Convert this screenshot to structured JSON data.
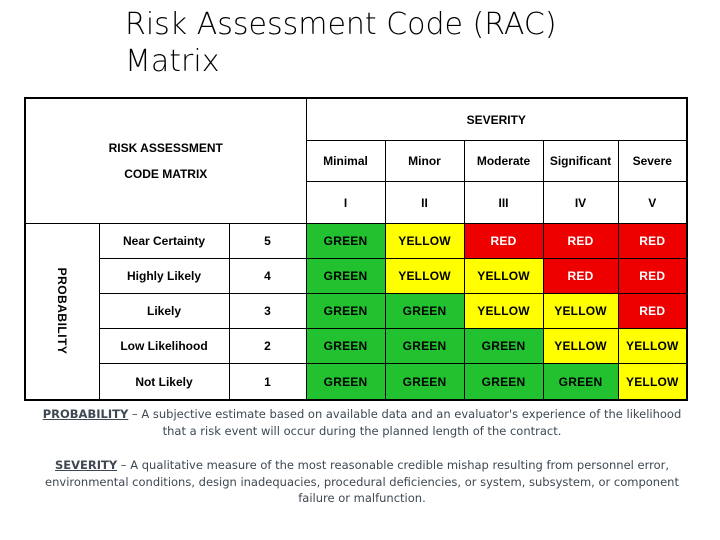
{
  "title": {
    "line1": "Risk Assessment Code (RAC)",
    "line2": "Matrix"
  },
  "matrix": {
    "corner_title_line1": "RISK ASSESSMENT",
    "corner_title_line2": "CODE MATRIX",
    "severity_header": "SEVERITY",
    "probability_axis_label": "PROBABILITY",
    "severity_columns": [
      {
        "name": "Minimal",
        "roman": "I"
      },
      {
        "name": "Minor",
        "roman": "II"
      },
      {
        "name": "Moderate",
        "roman": "III"
      },
      {
        "name": "Significant",
        "roman": "IV"
      },
      {
        "name": "Severe",
        "roman": "V"
      }
    ],
    "rows": [
      {
        "label": "Near Certainty",
        "value": "5",
        "cells": [
          {
            "text": "GREEN",
            "level": "GREEN"
          },
          {
            "text": "YELLOW",
            "level": "YELLOW"
          },
          {
            "text": "RED",
            "level": "RED"
          },
          {
            "text": "RED",
            "level": "RED"
          },
          {
            "text": "RED",
            "level": "RED"
          }
        ]
      },
      {
        "label": "Highly Likely",
        "value": "4",
        "cells": [
          {
            "text": "GREEN",
            "level": "GREEN"
          },
          {
            "text": "YELLOW",
            "level": "YELLOW"
          },
          {
            "text": "YELLOW",
            "level": "YELLOW"
          },
          {
            "text": "RED",
            "level": "RED"
          },
          {
            "text": "RED",
            "level": "RED"
          }
        ]
      },
      {
        "label": "Likely",
        "value": "3",
        "cells": [
          {
            "text": "GREEN",
            "level": "GREEN"
          },
          {
            "text": "GREEN",
            "level": "GREEN"
          },
          {
            "text": "YELLOW",
            "level": "YELLOW"
          },
          {
            "text": "YELLOW",
            "level": "YELLOW"
          },
          {
            "text": "RED",
            "level": "RED"
          }
        ]
      },
      {
        "label": "Low Likelihood",
        "value": "2",
        "cells": [
          {
            "text": "GREEN",
            "level": "GREEN"
          },
          {
            "text": "GREEN",
            "level": "GREEN"
          },
          {
            "text": "GREEN",
            "level": "GREEN"
          },
          {
            "text": "YELLOW",
            "level": "YELLOW"
          },
          {
            "text": "YELLOW",
            "level": "YELLOW"
          }
        ]
      },
      {
        "label": "Not Likely",
        "value": "1",
        "cells": [
          {
            "text": "GREEN",
            "level": "GREEN"
          },
          {
            "text": "GREEN",
            "level": "GREEN"
          },
          {
            "text": "GREEN",
            "level": "GREEN"
          },
          {
            "text": "GREEN",
            "level": "GREEN"
          },
          {
            "text": "YELLOW",
            "level": "YELLOW"
          }
        ]
      }
    ]
  },
  "definitions": [
    {
      "term": "PROBABILITY",
      "dash": " – ",
      "text": "A subjective estimate based on available data and an evaluator's experience of the likelihood that a risk event will occur during the planned length of the contract."
    },
    {
      "term": "SEVERITY",
      "dash": " – ",
      "text": "A qualitative measure of the most reasonable credible mishap resulting from personnel error, environmental conditions, design inadequacies, procedural deficiencies, or system, subsystem, or component failure or malfunction."
    }
  ],
  "colors": {
    "green": "#22c12f",
    "yellow": "#ffff00",
    "red": "#ee0000",
    "border": "#000000",
    "footer_text": "#3d4852"
  }
}
